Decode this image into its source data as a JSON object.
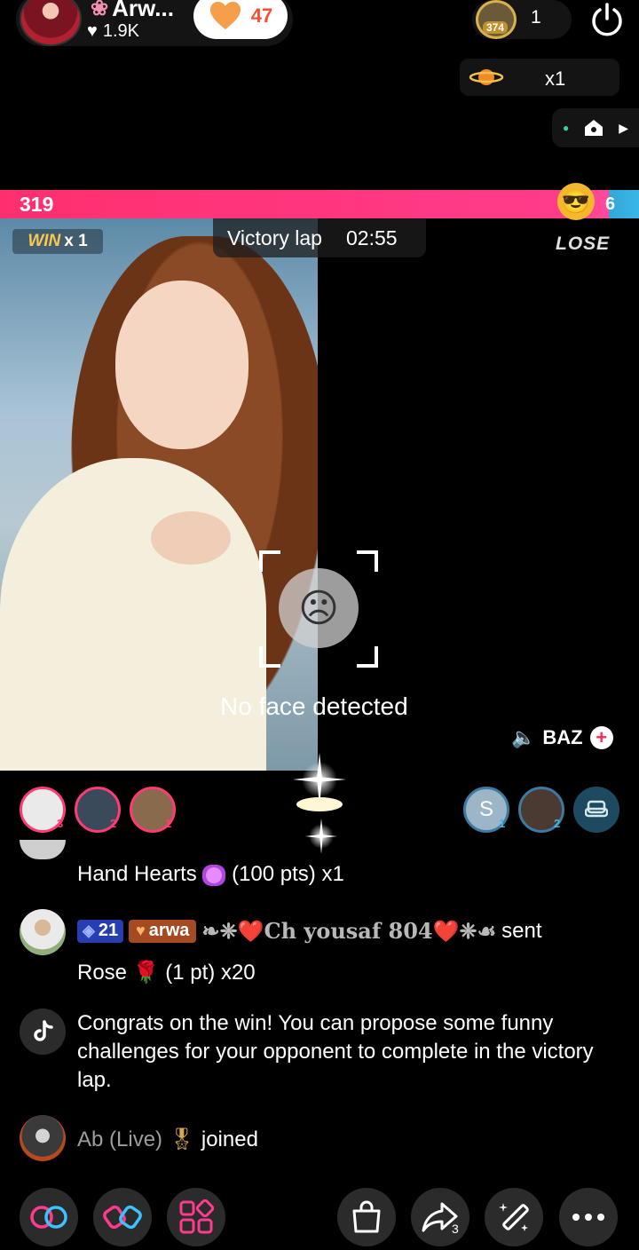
{
  "host": {
    "name": "Arw...",
    "likes": "1.9K",
    "follow_count": "47"
  },
  "viewers": {
    "avatar_badge": "374",
    "count": "1"
  },
  "planet": {
    "label": "x1"
  },
  "battle": {
    "score_left": "319",
    "score_right": "6",
    "score_left_fraction": 0.98,
    "win_label": "WIN",
    "win_count": "x 1",
    "victory_title": "Victory lap",
    "victory_time": "02:55",
    "lose_label": "LOSE",
    "no_face_text": "No face detected",
    "opponent_name": "BAZ"
  },
  "supporters_left": [
    {
      "rank": "3"
    },
    {
      "rank": "2"
    },
    {
      "rank": "1"
    }
  ],
  "supporters_right": [
    {
      "initial": "S",
      "rank": "1"
    },
    {
      "rank": "2"
    },
    {
      "rank": ""
    }
  ],
  "chat": {
    "msg1": {
      "text_a": "Hand Hearts",
      "text_b": "(100 pts) x1"
    },
    "msg2": {
      "level": "21",
      "fan_badge": "arwa",
      "sender": "❧❈❤️Ch yousaf 804❤️❈☙",
      "action": "sent",
      "gift": "Rose",
      "gift_detail": "(1 pt) x20"
    },
    "msg3": {
      "text": "Congrats on the win! You can propose some funny challenges for your opponent to complete in the victory lap."
    },
    "msg4": {
      "user": "Ab (Live)",
      "action": "joined"
    }
  },
  "toolbar": {
    "share_count": "3"
  },
  "colors": {
    "score_pink": "#ff2f6f",
    "score_blue": "#39b7e6",
    "win_gold": "#f7c94c",
    "follow_orange": "#f4502f"
  }
}
